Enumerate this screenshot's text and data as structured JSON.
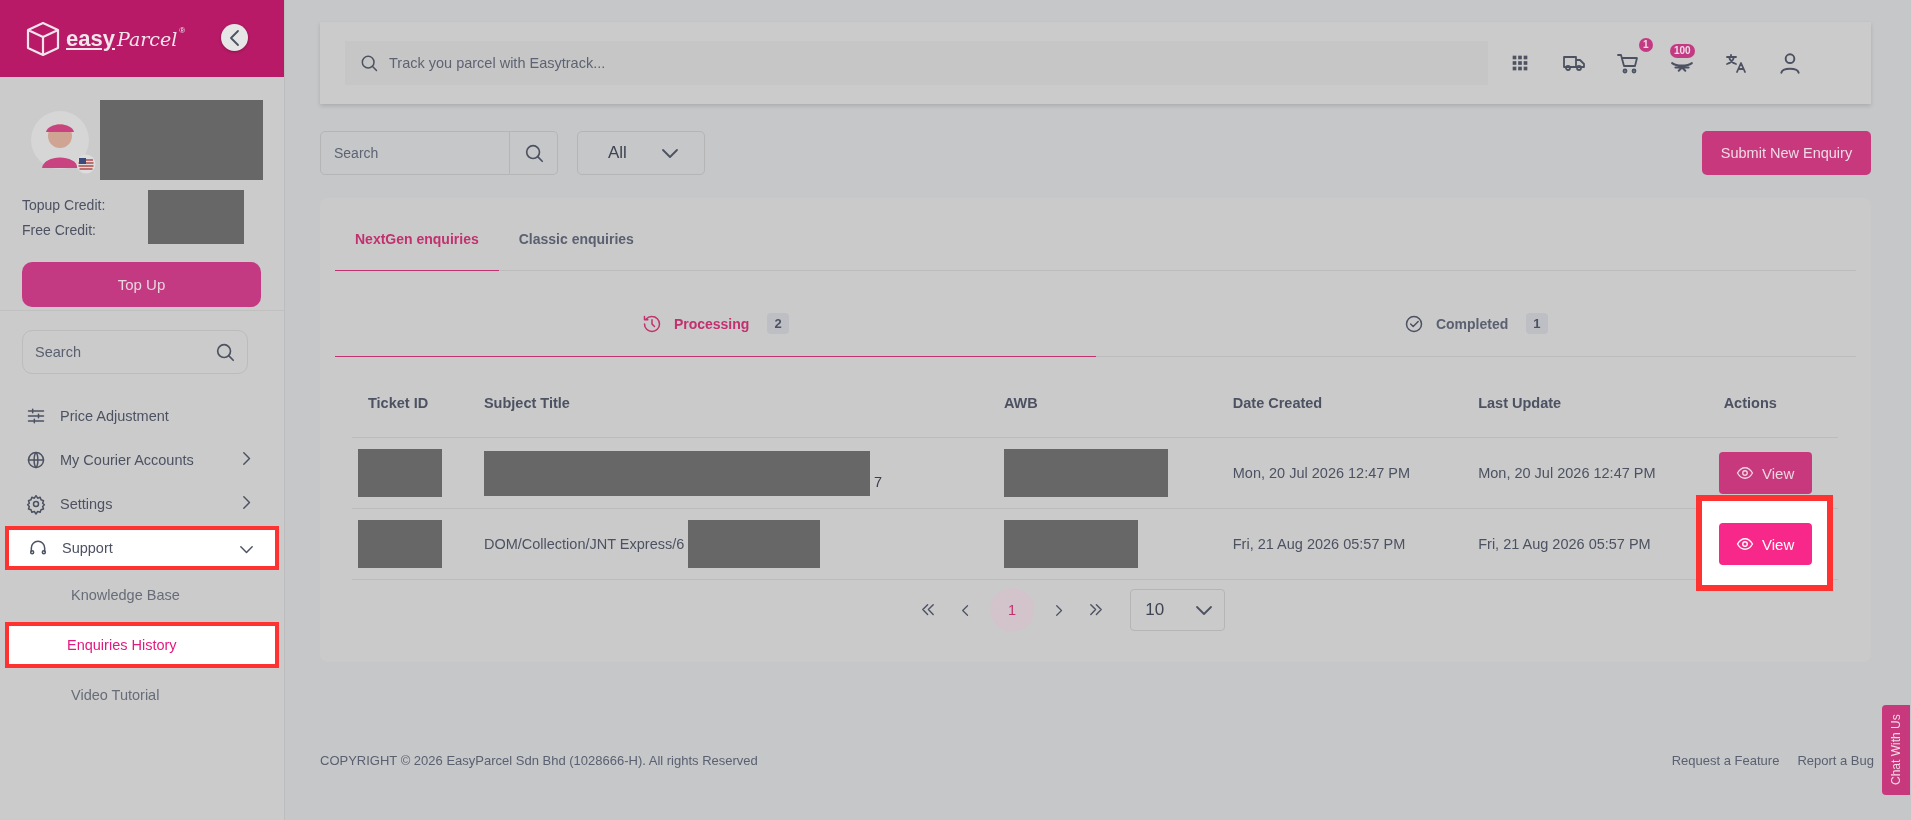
{
  "brand": {
    "name_bold": "easy",
    "name_script": "Parcel",
    "registered": "®"
  },
  "profile": {
    "credits": [
      {
        "label": "Topup Credit:"
      },
      {
        "label": "Free Credit:"
      }
    ],
    "topup_button": "Top Up"
  },
  "sidebar": {
    "search": {
      "placeholder": "Search"
    },
    "items": [
      {
        "label": "Price Adjustment",
        "kind": "link",
        "highlighted": false
      },
      {
        "label": "My Courier Accounts",
        "kind": "submenu",
        "expanded": false,
        "highlighted": false
      },
      {
        "label": "Settings",
        "kind": "submenu",
        "expanded": false,
        "highlighted": false
      },
      {
        "label": "Support",
        "kind": "submenu",
        "expanded": true,
        "highlighted": true,
        "children": [
          {
            "label": "Knowledge Base",
            "selected": false,
            "highlighted": false
          },
          {
            "label": "Enquiries History",
            "selected": true,
            "highlighted": true
          },
          {
            "label": "Video Tutorial",
            "selected": false,
            "highlighted": false
          }
        ]
      }
    ]
  },
  "topbar": {
    "track": {
      "placeholder": "Track you parcel with Easytrack..."
    },
    "cart_badge": "1",
    "coins_badge": "100"
  },
  "toolbar": {
    "search": {
      "placeholder": "Search"
    },
    "filter": "All",
    "submit_button": "Submit New Enquiry"
  },
  "tabs": [
    {
      "label": "NextGen enquiries",
      "selected": true
    },
    {
      "label": "Classic enquiries",
      "selected": false
    }
  ],
  "subtabs": [
    {
      "label": "Processing",
      "count": "2",
      "selected": true
    },
    {
      "label": "Completed",
      "count": "1",
      "selected": false
    }
  ],
  "table": {
    "columns": [
      "Ticket ID",
      "Subject Title",
      "AWB",
      "Date Created",
      "Last Update",
      "Actions"
    ],
    "rows": [
      {
        "subject": "7",
        "date_created": "Mon, 20 Jul 2026 12:47 PM",
        "last_update": "Mon, 20 Jul 2026 12:47 PM",
        "action": "View",
        "highlighted": false
      },
      {
        "subject": "DOM/Collection/JNT Express/6",
        "date_created": "Fri, 21 Aug 2026 05:57 PM",
        "last_update": "Fri, 21 Aug 2026 05:57 PM",
        "action": "View",
        "highlighted": true
      }
    ]
  },
  "pagination": {
    "pages": [
      {
        "label": "1",
        "selected": true
      }
    ],
    "page_size": "10"
  },
  "footer": {
    "copyright": "COPYRIGHT © 2026 EasyParcel Sdn Bhd (1028666-H). All rights Reserved",
    "links": [
      "Request a Feature",
      "Report a Bug"
    ]
  },
  "chat_button": "Chat With Us"
}
